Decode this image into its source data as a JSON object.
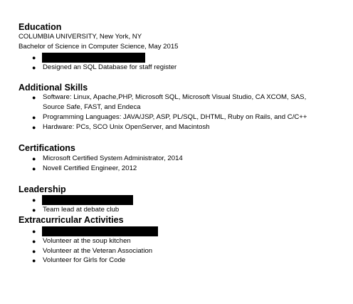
{
  "education": {
    "title": "Education",
    "school": "COLUMBIA UNIVERSITY, New York, NY",
    "degree": "Bachelor of Science in Computer Science, May 2015",
    "items": [
      "",
      "Designed an SQL Database for staff register"
    ]
  },
  "skills": {
    "title": "Additional Skills",
    "items": [
      "Software: Linux, Apache,PHP, Microsoft SQL, Microsoft Visual Studio, CA XCOM, SAS,",
      "Source Safe, FAST, and Endeca",
      "Programming Languages: JAVA/JSP, ASP, PL/SQL, DHTML, Ruby on Rails, and C/C++",
      "Hardware: PCs, SCO Unix OpenServer, and Macintosh"
    ]
  },
  "certifications": {
    "title": "Certifications",
    "items": [
      "Microsoft Certified System Administrator, 2014",
      "Novell Certified Engineer, 2012"
    ]
  },
  "leadership": {
    "title": "Leadership",
    "items": [
      "",
      "Team lead at debate club"
    ]
  },
  "extracurricular": {
    "title": "Extracurricular Activities",
    "items": [
      "",
      "Volunteer at the soup kitchen",
      "Volunteer at the Veteran Association",
      "Volunteer for Girls for Code"
    ]
  },
  "bullet_glyph": "●"
}
